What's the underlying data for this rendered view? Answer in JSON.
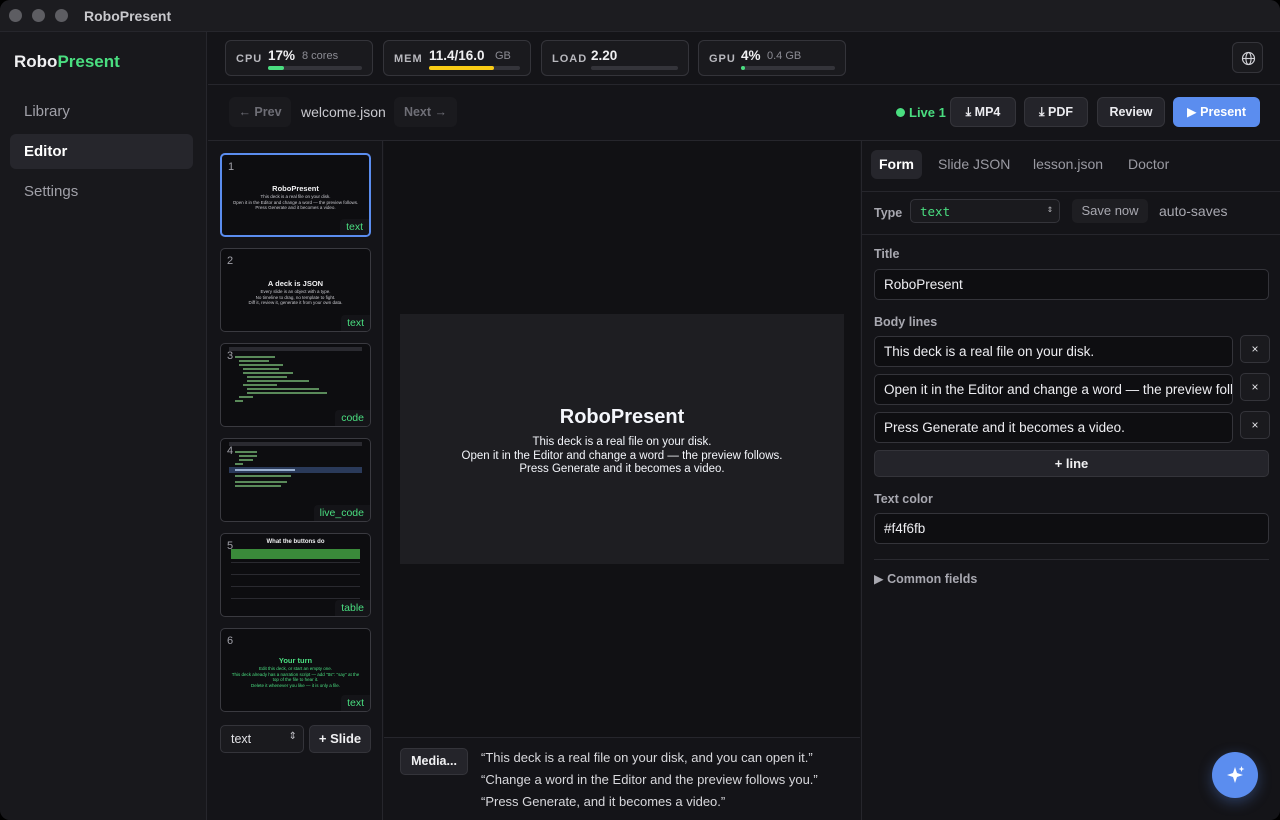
{
  "window": {
    "title": "RoboPresent"
  },
  "sidebar": {
    "brand_prefix": "Robo",
    "brand_suffix": "Present",
    "items": [
      {
        "label": "Library",
        "active": false
      },
      {
        "label": "Editor",
        "active": true
      },
      {
        "label": "Settings",
        "active": false
      }
    ]
  },
  "stats": [
    {
      "label": "CPU",
      "value": "17%",
      "sub": "8 cores",
      "fraction": 0.17,
      "color": "#4ade80"
    },
    {
      "label": "MEM",
      "value": "11.4/16.0",
      "sub": "GB",
      "fraction": 0.71,
      "color": "#facc15"
    },
    {
      "label": "LOAD",
      "value": "2.20",
      "sub": "",
      "fraction": 0.0,
      "color": "#4ade80"
    },
    {
      "label": "GPU",
      "value": "4%",
      "sub": "0.4 GB",
      "fraction": 0.04,
      "color": "#4ade80"
    }
  ],
  "toolbar": {
    "prev": "← Prev",
    "filename": "welcome.json",
    "next": "Next →",
    "live": "Live 1",
    "mp4": "MP4",
    "pdf": "PDF",
    "review": "Review",
    "present": "Present"
  },
  "slides": [
    {
      "num": "1",
      "type": "text",
      "title": "RoboPresent",
      "body": [
        "This deck is a real file on your disk.",
        "Open it in the Editor and change a word — the preview follows.",
        "Press Generate and it becomes a video."
      ]
    },
    {
      "num": "2",
      "type": "text",
      "title": "A deck is JSON",
      "body": [
        "Every slide is an object with a type.",
        "No timeline to drag, no template to fight.",
        "Diff it, review it, generate it from your own data."
      ]
    },
    {
      "num": "3",
      "type": "code"
    },
    {
      "num": "4",
      "type": "live_code"
    },
    {
      "num": "5",
      "type": "table",
      "title": "What the buttons do"
    },
    {
      "num": "6",
      "type": "text",
      "title": "Your turn",
      "body": [
        "Edit this deck, or start an empty one.",
        "This deck already has a narration script — add \"tts\": \"say\" at the top of the file to hear it.",
        "Delete it whenever you like — it is only a file."
      ]
    }
  ],
  "add_slide": {
    "type_value": "text",
    "button": "+ Slide"
  },
  "preview": {
    "title": "RoboPresent",
    "body": [
      "This deck is a real file on your disk.",
      "Open it in the Editor and change a word — the preview follows.",
      "Press Generate and it becomes a video."
    ],
    "text_color": "#f4f6fb"
  },
  "notes": {
    "media_button": "Media...",
    "lines": [
      "“This deck is a real file on your disk, and you can open it.”",
      "“Change a word in the Editor and the preview follows you.”",
      "“Press Generate, and it becomes a video.”"
    ]
  },
  "panel": {
    "tabs": [
      {
        "label": "Form",
        "active": true
      },
      {
        "label": "Slide JSON",
        "active": false
      },
      {
        "label": "lesson.json",
        "active": false
      },
      {
        "label": "Doctor",
        "active": false
      }
    ],
    "type_label": "Type",
    "type_value": "text",
    "save_now": "Save now",
    "autosave": "auto-saves",
    "title_label": "Title",
    "title_value": "RoboPresent",
    "body_label": "Body lines",
    "body_lines": [
      "This deck is a real file on your disk.",
      "Open it in the Editor and change a word — the preview follows.",
      "Press Generate and it becomes a video."
    ],
    "remove_glyph": "×",
    "add_line": "+ line",
    "text_color_label": "Text color",
    "text_color_value": "#f4f6fb",
    "common_fields": "▶ Common fields"
  }
}
